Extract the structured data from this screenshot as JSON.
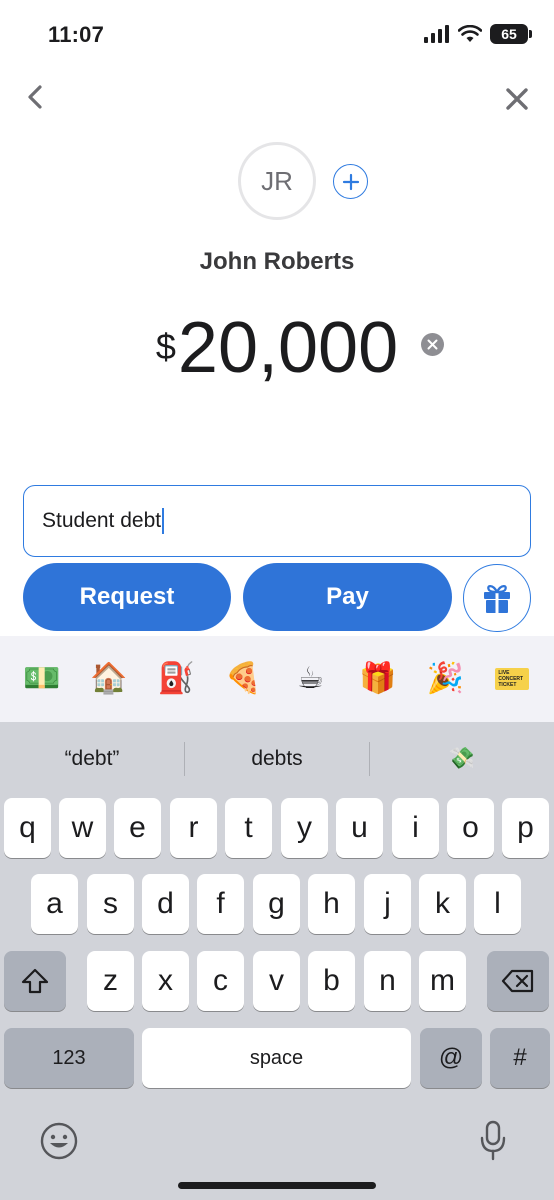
{
  "status_bar": {
    "time": "11:07",
    "battery": "65"
  },
  "nav": {
    "back_icon": "chevron-left-icon",
    "close_icon": "close-icon"
  },
  "recipient": {
    "initials": "JR",
    "name": "John Roberts"
  },
  "amount": {
    "currency_symbol": "$",
    "value": "20,000"
  },
  "note": {
    "value": "Student debt"
  },
  "actions": {
    "request_label": "Request",
    "pay_label": "Pay",
    "gift_icon": "gift-icon"
  },
  "emoji_suggestions": [
    "💵",
    "🏠",
    "⛽",
    "🍕",
    "☕",
    "🎁",
    "🎉"
  ],
  "ticket_sticker": {
    "line1": "LIVE",
    "line2": "CONCERT",
    "line3": "TICKET"
  },
  "keyboard": {
    "suggestions": [
      "“debt”",
      "debts",
      "💸"
    ],
    "row1": [
      "q",
      "w",
      "e",
      "r",
      "t",
      "y",
      "u",
      "i",
      "o",
      "p"
    ],
    "row2": [
      "a",
      "s",
      "d",
      "f",
      "g",
      "h",
      "j",
      "k",
      "l"
    ],
    "row3": [
      "z",
      "x",
      "c",
      "v",
      "b",
      "n",
      "m"
    ],
    "numbers_label": "123",
    "space_label": "space",
    "at_label": "@",
    "hash_label": "#"
  },
  "colors": {
    "accent": "#2f74d8",
    "keyboard_bg": "#d1d3d9",
    "emoji_strip_bg": "#f2f2f7"
  }
}
